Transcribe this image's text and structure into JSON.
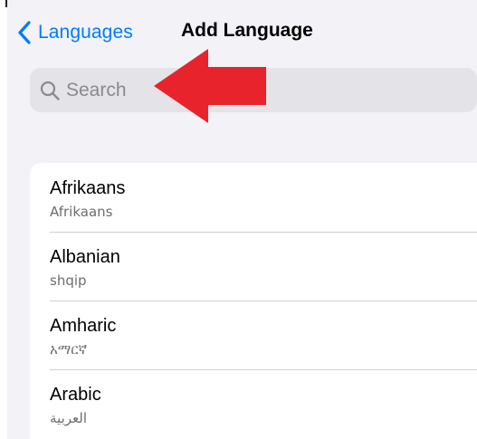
{
  "nav": {
    "back_label": "Languages",
    "title": "Add Language"
  },
  "search": {
    "placeholder": "Search",
    "value": ""
  },
  "annotation": {
    "arrow_color": "#e8232b",
    "points_to": "search-input"
  },
  "languages": [
    {
      "name": "Afrikaans",
      "native": "Afrikaans"
    },
    {
      "name": "Albanian",
      "native": "shqip"
    },
    {
      "name": "Amharic",
      "native": "አማርኛ"
    },
    {
      "name": "Arabic",
      "native": "العربية"
    }
  ],
  "colors": {
    "accent": "#007aff",
    "background": "#f2f2f7",
    "search_fill": "#e3e3e8",
    "separator": "#d1d1d6",
    "secondary_text": "#6d6d72"
  },
  "icons": {
    "back": "chevron-left-icon",
    "search": "magnifying-glass-icon",
    "annotation": "red-arrow-left-icon"
  }
}
